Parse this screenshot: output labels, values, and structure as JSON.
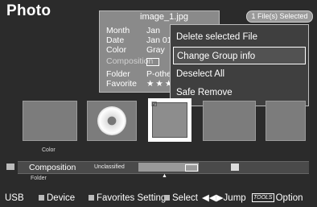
{
  "title": "Photo",
  "selected_badge": "1 File(s) Selected",
  "info": {
    "filename": "image_1.jpg",
    "rows": [
      {
        "label": "Month",
        "value": "Jan"
      },
      {
        "label": "Date",
        "value": "Jan 01"
      },
      {
        "label": "Color",
        "value": "Gray"
      },
      {
        "label": "Composition",
        "value": ""
      },
      {
        "label": "Folder",
        "value": "P-other"
      },
      {
        "label": "Favorite",
        "value": "★★★"
      }
    ]
  },
  "menu": [
    "Delete selected File",
    "Change Group info",
    "Deselect All",
    "Safe Remove"
  ],
  "sort": {
    "color_label": "Color",
    "current": "Composition",
    "group": "Unclassified",
    "folder_label": "Folder"
  },
  "footer": {
    "source": "USB",
    "device": "Device",
    "favorites": "Favorites Setting",
    "select": "Select",
    "jump": "Jump",
    "tools_key": "TOOLS",
    "option": "Option"
  },
  "colors": {
    "background": "#2b2b2b",
    "panel": "#8a8a8a",
    "menu": "#3f3f3f"
  }
}
